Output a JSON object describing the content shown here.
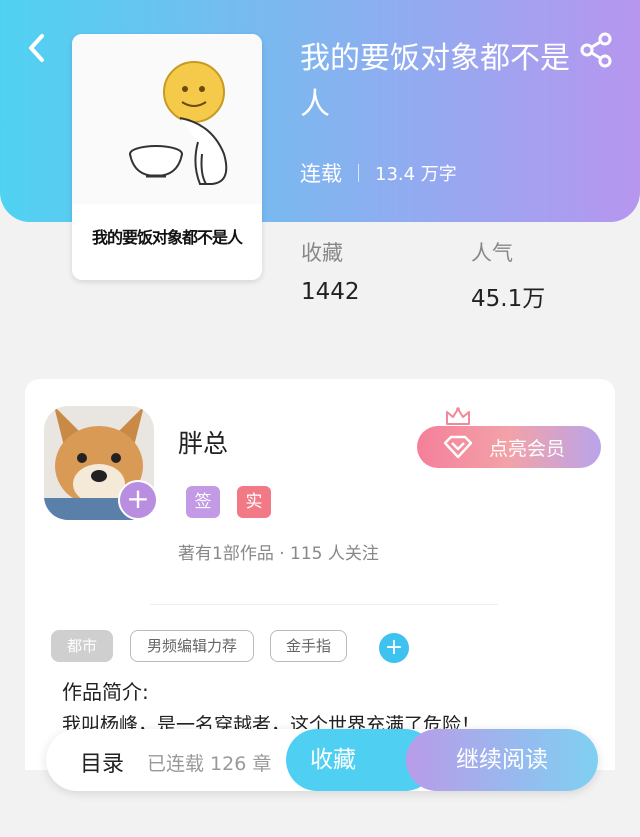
{
  "book": {
    "title": "我的要饭对象都不是人",
    "status": "连载",
    "word_count": "13.4 万字",
    "cover_caption": "我的要饭对象都不是人"
  },
  "stats": {
    "collect_label": "收藏",
    "collect_value": "1442",
    "popularity_label": "人气",
    "popularity_value": "45.1万"
  },
  "author": {
    "name": "胖总",
    "badge_sign": "签",
    "badge_real": "实",
    "avatar_plus": "+",
    "description": "著有1部作品 · 115 人关注",
    "vip_label": "点亮会员"
  },
  "tags": {
    "items": [
      "都市",
      "男频编辑力荐",
      "金手指"
    ],
    "add": "+"
  },
  "intro": {
    "title": "作品简介:",
    "text": "我叫杨峰，是一名穿越者，这个世界充满了危险！"
  },
  "bottom_bar": {
    "toc_label": "目录",
    "chapter_count": "已连载 126 章",
    "collect_label": "收藏",
    "read_label": "继续阅读"
  },
  "colors": {
    "header_start": "#4fd2f2",
    "header_end": "#b796ef",
    "accent_blue": "#3ec3f0",
    "accent_purple": "#b98de0",
    "accent_red": "#f27a86"
  },
  "icons": {
    "back": "chevron-left-icon",
    "share": "share-icon",
    "crown": "crown-icon",
    "diamond": "diamond-icon"
  }
}
